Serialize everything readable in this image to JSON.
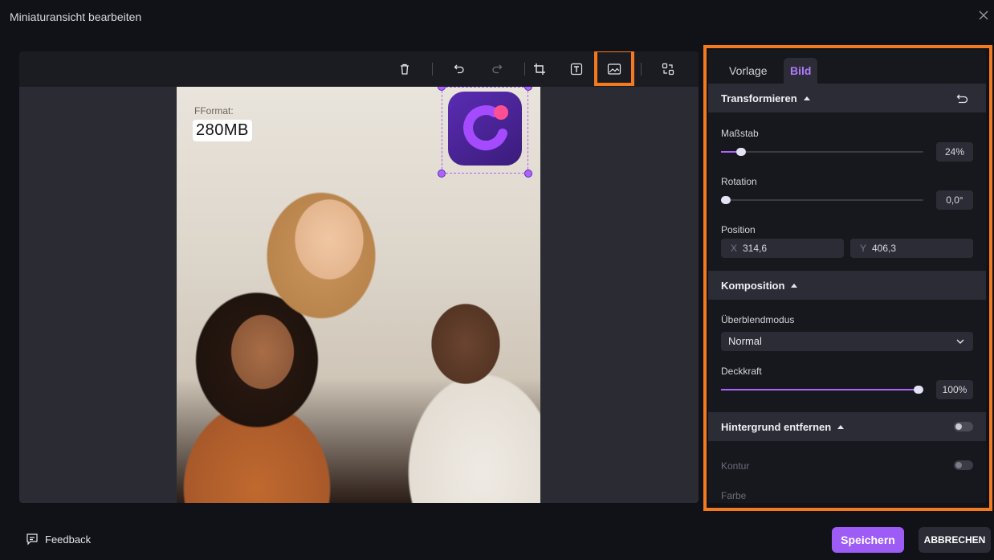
{
  "window": {
    "title": "Miniaturansicht bearbeiten"
  },
  "toolbar": {
    "icons": [
      "trash-icon",
      "undo-icon",
      "redo-icon",
      "crop-icon",
      "text-icon",
      "image-icon",
      "replace-icon"
    ]
  },
  "canvas": {
    "format_label": "FFormat:",
    "format_value": "280MB"
  },
  "panel": {
    "tabs": [
      {
        "label": "Vorlage"
      },
      {
        "label": "Bild"
      }
    ],
    "active_tab": "Bild",
    "transform": {
      "title": "Transformieren",
      "scale": {
        "label": "Maßstab",
        "value": "24%",
        "level": 0.08
      },
      "rotation": {
        "label": "Rotation",
        "value": "0,0°",
        "level": 0.0
      },
      "position": {
        "label": "Position",
        "x_axis": "X",
        "x": "314,6",
        "y_axis": "Y",
        "y": "406,3"
      }
    },
    "composition": {
      "title": "Komposition",
      "blend_mode": {
        "label": "Überblendmodus",
        "value": "Normal"
      },
      "opacity": {
        "label": "Deckkraft",
        "value": "100%",
        "level": 1.0
      }
    },
    "background_removal": {
      "title": "Hintergrund entfernen",
      "enabled": false,
      "contour": {
        "label": "Kontur",
        "enabled": false
      },
      "color": {
        "label": "Farbe"
      }
    }
  },
  "footer": {
    "feedback": "Feedback",
    "save": "Speichern",
    "cancel": "ABBRECHEN"
  },
  "colors": {
    "accent": "#9e5cf6",
    "highlight": "#f47a1f",
    "active_tab": "#b07bff"
  }
}
